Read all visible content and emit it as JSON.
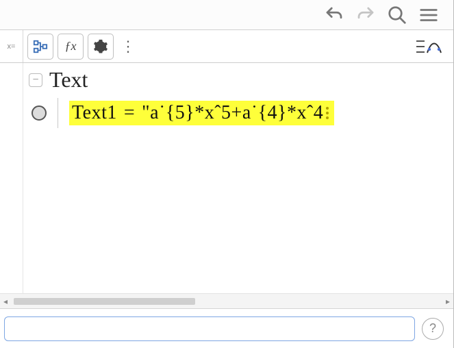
{
  "top": {
    "undo": "undo",
    "redo": "redo",
    "search": "search",
    "menu": "menu"
  },
  "panel": {
    "left_label": "x=",
    "tree_view": "tree-view",
    "fx_label": "ƒx",
    "settings": "settings",
    "more": "⋮",
    "graphing": "graphing-view"
  },
  "algebra": {
    "group_title": "Text",
    "collapse_glyph": "−",
    "items": [
      {
        "name": "Text1",
        "eq": "=",
        "value": "\"a˙{5}*xˆ5+a˙{4}*xˆ4",
        "visible": false
      }
    ]
  },
  "input": {
    "placeholder": ""
  },
  "help": {
    "glyph": "?"
  }
}
